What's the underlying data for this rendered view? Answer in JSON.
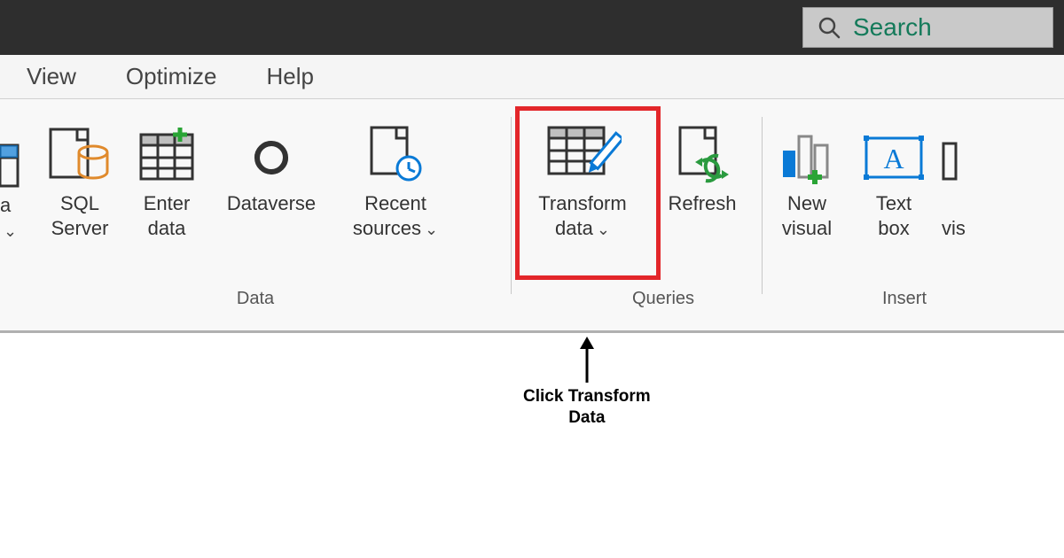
{
  "titlebar": {
    "search_placeholder": "Search"
  },
  "tabs": {
    "view": "View",
    "optimize": "Optimize",
    "help": "Help"
  },
  "ribbon": {
    "data_group": {
      "label": "Data",
      "partial_item": {
        "line1": "a",
        "dropdown": true
      },
      "sql": {
        "line1": "SQL",
        "line2": "Server"
      },
      "enter": {
        "line1": "Enter",
        "line2": "data"
      },
      "dataverse": {
        "line1": "Dataverse"
      },
      "recent": {
        "line1": "Recent",
        "line2": "sources",
        "dropdown": true
      }
    },
    "queries_group": {
      "label": "Queries",
      "transform": {
        "line1": "Transform",
        "line2": "data",
        "dropdown": true
      },
      "refresh": {
        "line1": "Refresh"
      }
    },
    "insert_group": {
      "label": "Insert",
      "new_visual": {
        "line1": "New",
        "line2": "visual"
      },
      "text_box": {
        "line1": "Text",
        "line2": "box"
      },
      "more_vis": {
        "line1": "vis"
      }
    }
  },
  "annotation": {
    "line1": "Click Transform",
    "line2": "Data"
  }
}
